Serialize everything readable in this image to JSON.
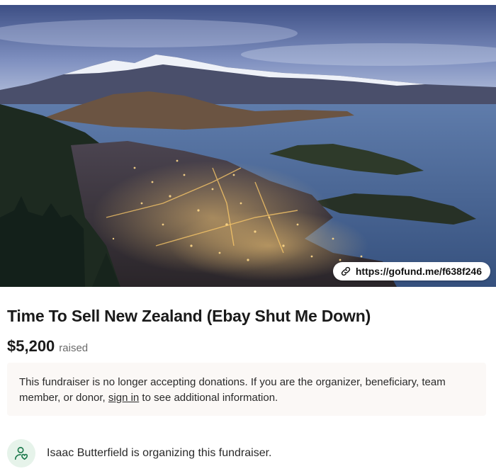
{
  "hero": {
    "image_alt": "Aerial view of Queenstown lit at dusk, Lake Wakatipu and snow-capped mountains",
    "share_link": "https://gofund.me/f638f246",
    "link_icon": "link-icon"
  },
  "campaign": {
    "title": "Time To Sell New Zealand (Ebay Shut Me Down)",
    "amount": "$5,200",
    "raised_label": "raised"
  },
  "notice": {
    "text_before": "This fundraiser is no longer accepting donations. If you are the organizer, beneficiary, team member, or donor, ",
    "link_text": "sign in",
    "text_after": " to see additional information."
  },
  "organizer": {
    "icon": "organizer-heart-icon",
    "text": "Isaac Butterfield is organizing this fundraiser."
  },
  "colors": {
    "notice_bg": "#fbf8f6",
    "organizer_icon_bg": "#e6f3ea",
    "organizer_icon_stroke": "#1d7a4d"
  }
}
